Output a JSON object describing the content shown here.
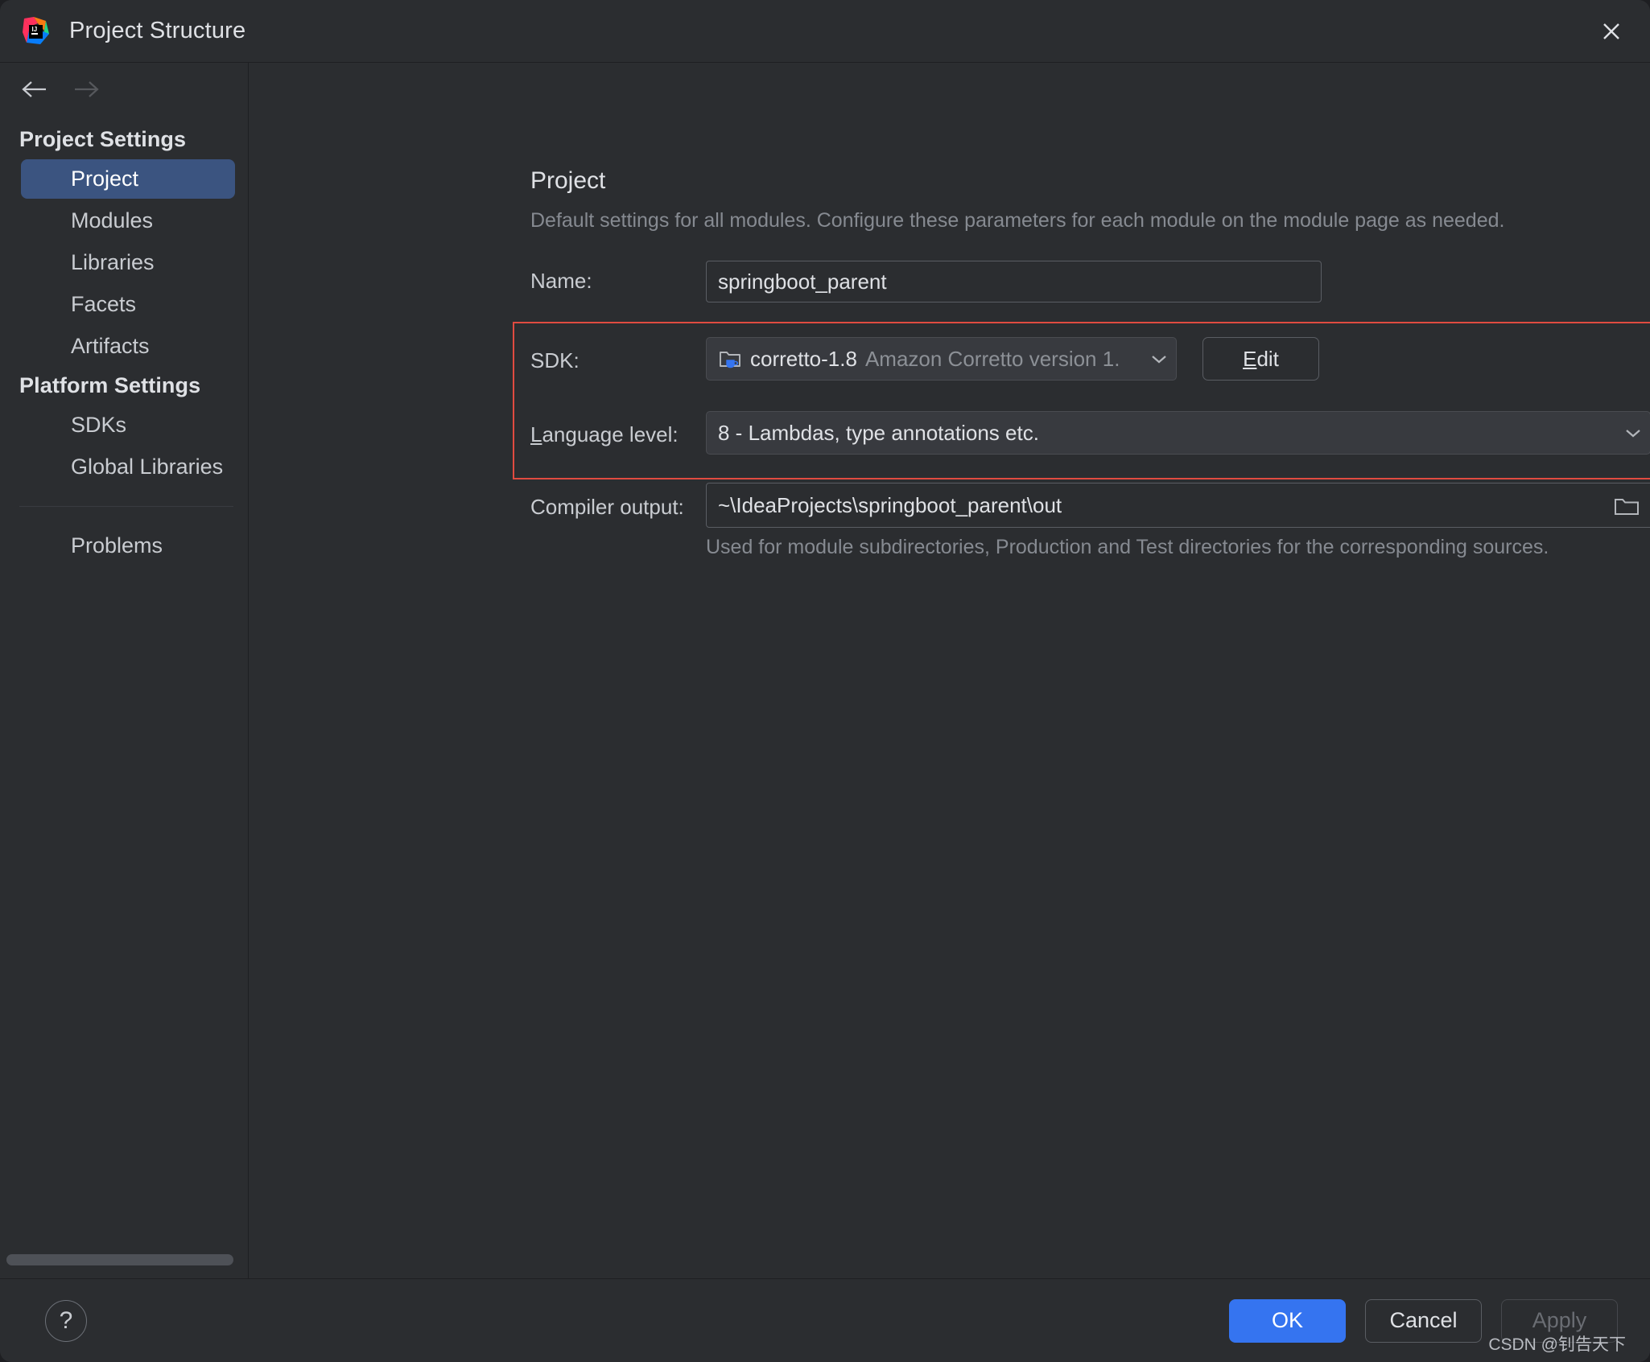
{
  "window": {
    "title": "Project Structure",
    "app_icon": "intellij-idea-logo",
    "close_icon": "close-icon"
  },
  "nav": {
    "back_icon": "arrow-left-icon",
    "forward_icon": "arrow-right-icon"
  },
  "sidebar": {
    "groups": [
      {
        "label": "Project Settings",
        "items": [
          {
            "label": "Project",
            "selected": true
          },
          {
            "label": "Modules",
            "selected": false
          },
          {
            "label": "Libraries",
            "selected": false
          },
          {
            "label": "Facets",
            "selected": false
          },
          {
            "label": "Artifacts",
            "selected": false
          }
        ]
      },
      {
        "label": "Platform Settings",
        "items": [
          {
            "label": "SDKs",
            "selected": false
          },
          {
            "label": "Global Libraries",
            "selected": false
          }
        ]
      }
    ],
    "extra_items": [
      {
        "label": "Problems",
        "selected": false
      }
    ]
  },
  "main": {
    "title": "Project",
    "subtitle": "Default settings for all modules. Configure these parameters for each module on the module page as needed.",
    "name_label": "Name:",
    "name_value": "springboot_parent",
    "sdk_label": "SDK:",
    "sdk_icon": "jdk-folder-icon",
    "sdk_value": "corretto-1.8",
    "sdk_value_secondary": "Amazon Corretto version 1.",
    "sdk_chevron_icon": "chevron-down-icon",
    "edit_button": "Edit",
    "edit_button_mnemonic": "E",
    "edit_button_rest": "dit",
    "language_level_label": "Language level:",
    "language_level_mnemonic": "L",
    "language_level_label_rest": "anguage level:",
    "language_level_value": "8 - Lambdas, type annotations etc.",
    "language_level_chevron_icon": "chevron-down-icon",
    "compiler_output_label": "Compiler output:",
    "compiler_output_value": "~\\IdeaProjects\\springboot_parent\\out",
    "compiler_output_browse_icon": "folder-icon",
    "compiler_output_hint": "Used for module subdirectories, Production and Test directories for the corresponding sources."
  },
  "highlight": {
    "color": "#e04b40"
  },
  "footer": {
    "help_icon": "question-mark-icon",
    "ok_label": "OK",
    "cancel_label": "Cancel",
    "apply_label": "Apply",
    "apply_disabled": true,
    "accent_color": "#3574f0"
  },
  "watermark": {
    "text": "CSDN @钊告天下"
  }
}
